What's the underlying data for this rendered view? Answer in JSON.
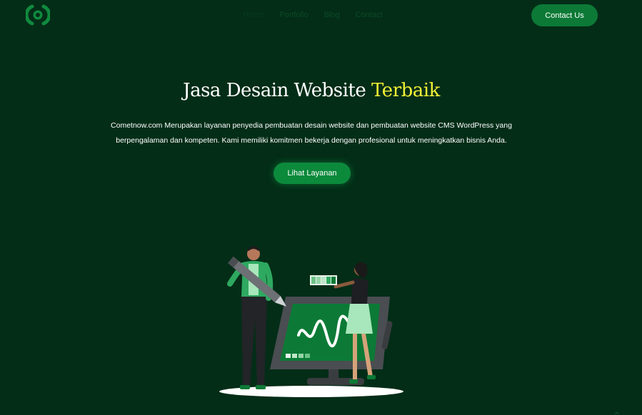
{
  "header": {
    "logo_icon": "brand-logo-icon",
    "nav": [
      {
        "label": "Home",
        "state": "active-dim"
      },
      {
        "label": "Portfolio"
      },
      {
        "label": "Blog"
      },
      {
        "label": "Contact"
      }
    ],
    "contact_button": "Contact Us"
  },
  "hero": {
    "title_main": "Jasa Desain Website ",
    "title_accent": "Terbaik",
    "description_line1": "Cometnow.com Merupakan layanan penyedia pembuatan desain website dan pembuatan website CMS WordPress yang",
    "description_line2": "berpengalaman dan kompeten. Kami memiliki komitmen bekerja dengan profesional untuk meningkatkan bisnis Anda.",
    "cta_button": "Lihat Layanan"
  },
  "illustration": {
    "icon": "web-design-team-illustration"
  },
  "colors": {
    "background": "#032d17",
    "brand_green": "#0c7a36",
    "accent_yellow": "#f2f236",
    "text": "#ffffff"
  }
}
